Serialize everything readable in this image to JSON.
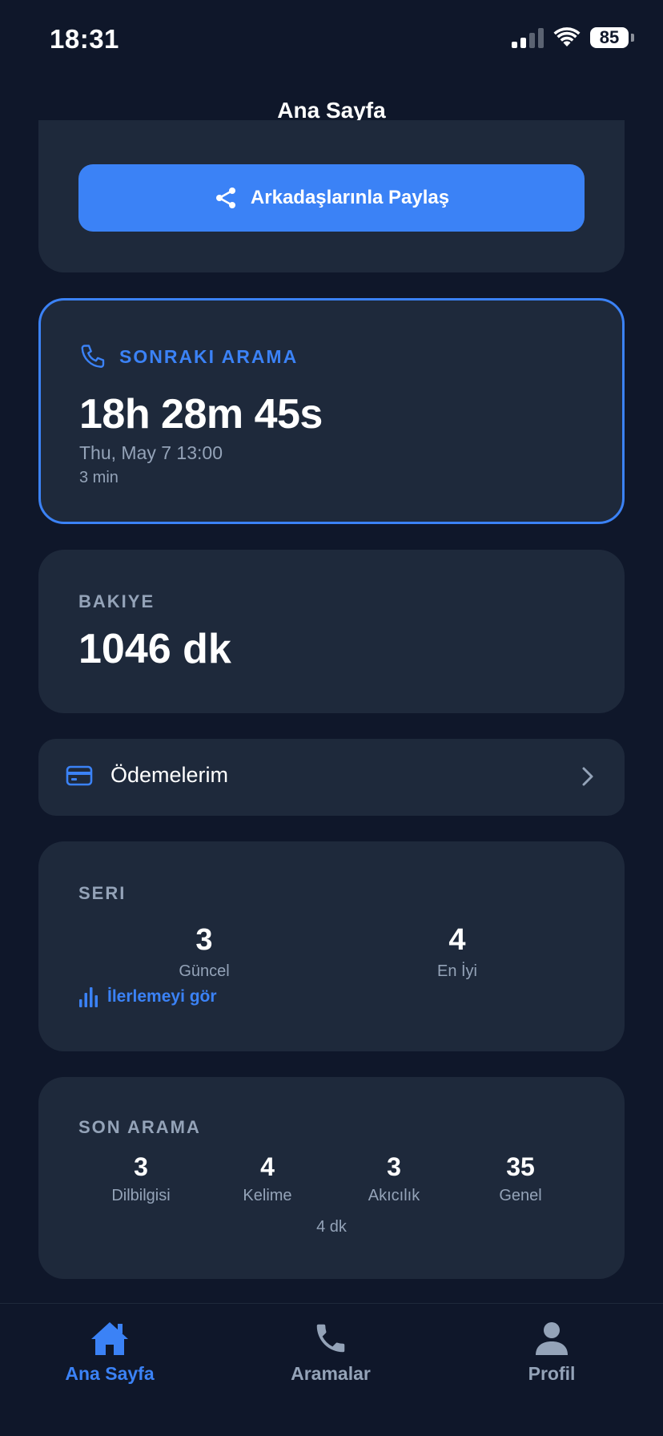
{
  "status_bar": {
    "time": "18:31",
    "battery": "85"
  },
  "nav": {
    "title": "Ana Sayfa"
  },
  "share": {
    "button_label": "Arkadaşlarınla Paylaş"
  },
  "next_call": {
    "label": "SONRAKI ARAMA",
    "countdown": "18h 28m 45s",
    "date": "Thu, May 7 13:00",
    "duration": "3 min"
  },
  "balance": {
    "label": "BAKIYE",
    "value": "1046 dk"
  },
  "payments": {
    "label": "Ödemelerim"
  },
  "streak": {
    "label": "SERI",
    "current_value": "3",
    "current_label": "Güncel",
    "best_value": "4",
    "best_label": "En İyi",
    "progress_link": "İlerlemeyi gör"
  },
  "last_call": {
    "label": "SON ARAMA",
    "stats": [
      {
        "value": "3",
        "label": "Dilbilgisi"
      },
      {
        "value": "4",
        "label": "Kelime"
      },
      {
        "value": "3",
        "label": "Akıcılık"
      },
      {
        "value": "35",
        "label": "Genel"
      }
    ],
    "duration": "4 dk"
  },
  "tabs": [
    {
      "label": "Ana Sayfa",
      "icon": "home-icon",
      "active": true
    },
    {
      "label": "Aramalar",
      "icon": "phone-icon",
      "active": false
    },
    {
      "label": "Profil",
      "icon": "person-icon",
      "active": false
    }
  ],
  "colors": {
    "background": "#0f172a",
    "card": "#1e293b",
    "accent": "#3b82f6",
    "muted_text": "#94a3b8"
  }
}
